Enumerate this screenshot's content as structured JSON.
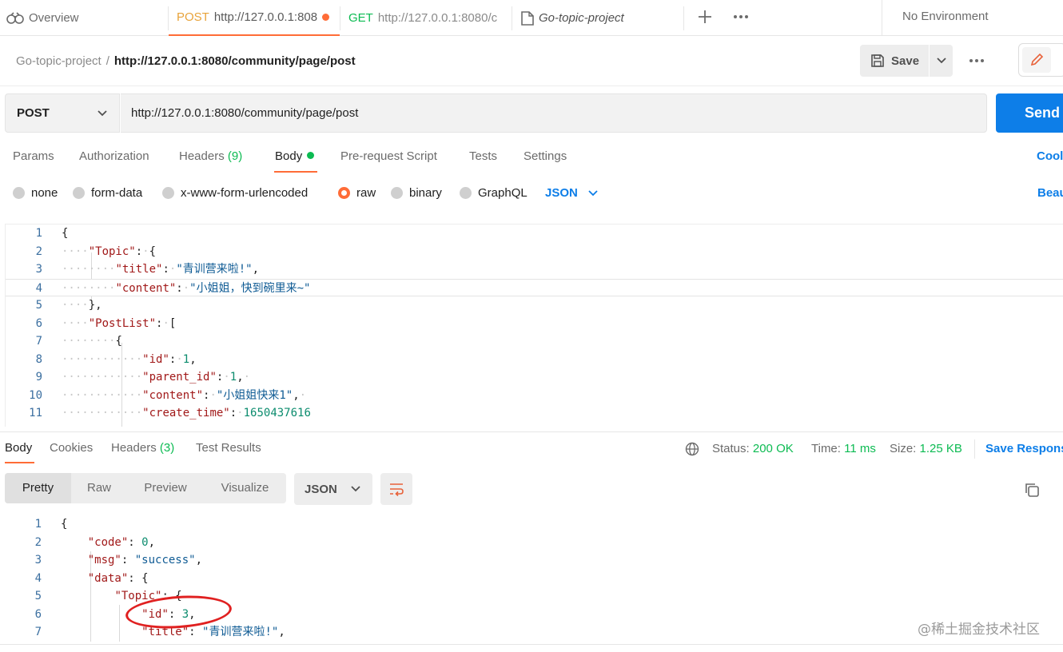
{
  "tabs": [
    {
      "label": "Overview"
    },
    {
      "method": "POST",
      "url": "http://127.0.0.1:808",
      "unsaved": true
    },
    {
      "method": "GET",
      "url": "http://127.0.0.1:8080/c"
    },
    {
      "label": "Go-topic-project"
    }
  ],
  "environment": "No Environment",
  "breadcrumb": {
    "collection": "Go-topic-project",
    "separator": "/",
    "request": "http://127.0.0.1:8080/community/page/post"
  },
  "header": {
    "save_label": "Save"
  },
  "request": {
    "method": "POST",
    "url": "http://127.0.0.1:8080/community/page/post",
    "send_label": "Send",
    "tabs": [
      {
        "label": "Params"
      },
      {
        "label": "Authorization"
      },
      {
        "label": "Headers",
        "count": "(9)"
      },
      {
        "label": "Body"
      },
      {
        "label": "Pre-request Script"
      },
      {
        "label": "Tests"
      },
      {
        "label": "Settings"
      }
    ],
    "cookies_label": "Cool",
    "body_types": [
      "none",
      "form-data",
      "x-www-form-urlencoded",
      "raw",
      "binary",
      "GraphQL"
    ],
    "selected_body_type": "raw",
    "body_format": "JSON",
    "beautify_label": "Beau",
    "line_numbers": [
      "1",
      "2",
      "3",
      "4",
      "5",
      "6",
      "7",
      "8",
      "9",
      "10",
      "11"
    ],
    "body_text": {
      "k_topic": "\"Topic\"",
      "k_title": "\"title\"",
      "v_title": "\"青训营来啦!\"",
      "k_content": "\"content\"",
      "v_content": "\"小姐姐，快到碗里来~\"",
      "k_postlist": "\"PostList\"",
      "k_id": "\"id\"",
      "v_id": "1",
      "k_parent_id": "\"parent_id\"",
      "v_parent_id": "1",
      "k_content2": "\"content\"",
      "v_content2": "\"小姐姐快来1\"",
      "k_create_time": "\"create_time\"",
      "v_create_time": "1650437616"
    }
  },
  "response": {
    "tabs": [
      {
        "label": "Body"
      },
      {
        "label": "Cookies"
      },
      {
        "label": "Headers",
        "count": "(3)"
      },
      {
        "label": "Test Results"
      }
    ],
    "status_label": "Status:",
    "status_value": "200 OK",
    "time_label": "Time:",
    "time_value": "11 ms",
    "size_label": "Size:",
    "size_value": "1.25 KB",
    "save_label": "Save Respons",
    "views": [
      "Pretty",
      "Raw",
      "Preview",
      "Visualize"
    ],
    "format": "JSON",
    "line_numbers": [
      "1",
      "2",
      "3",
      "4",
      "5",
      "6",
      "7"
    ],
    "body_text": {
      "k_code": "\"code\"",
      "v_code": "0",
      "k_msg": "\"msg\"",
      "v_msg": "\"success\"",
      "k_data": "\"data\"",
      "k_topic": "\"Topic\"",
      "k_id": "\"id\"",
      "v_id": "3",
      "k_title": "\"title\"",
      "v_title": "\"青训营来啦!\""
    }
  },
  "watermark": "@稀土掘金技术社区",
  "colors": {
    "accent": "#ff6c37",
    "primary": "#0d7ee8",
    "success": "#0cbb52",
    "json_key": "#a11919",
    "json_string": "#0f5b94",
    "json_number": "#0c8c6e"
  },
  "icons": [
    "overview-icon",
    "document-icon",
    "plus-icon",
    "more-icon",
    "save-icon",
    "chevron-down-icon",
    "edit-icon",
    "globe-icon",
    "wrap-lines-icon",
    "copy-icon"
  ]
}
